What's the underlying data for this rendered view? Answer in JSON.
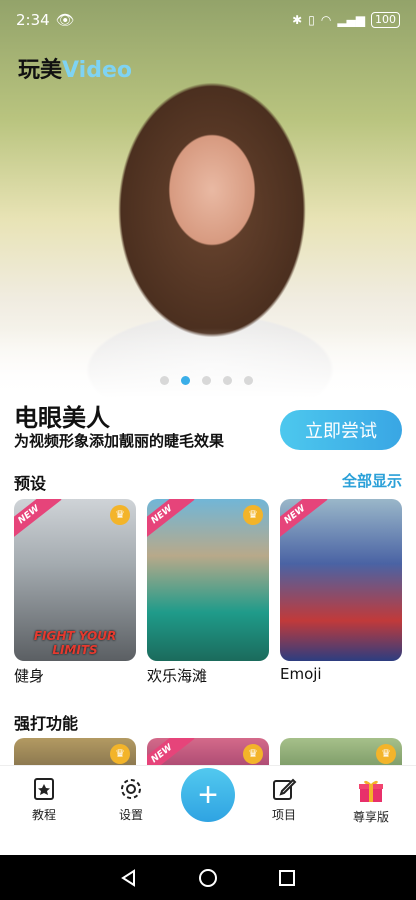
{
  "status_bar": {
    "time": "2:34",
    "battery": "100"
  },
  "app": {
    "logo_cn": "玩美",
    "logo_en": "Video"
  },
  "hero": {
    "slide_count": 5,
    "active_slide": 2
  },
  "feature": {
    "title": "电眼美人",
    "subtitle": "为视频形象添加靓丽的睫毛效果",
    "cta_label": "立即尝试"
  },
  "presets": {
    "title": "预设",
    "see_all": "全部显示",
    "items": [
      {
        "label": "健身",
        "caption": "FIGHT YOUR LIMITS",
        "badge": "NEW"
      },
      {
        "label": "欢乐海滩",
        "badge": "NEW"
      },
      {
        "label": "Emoji",
        "badge": "NEW"
      }
    ]
  },
  "features_section": {
    "title": "强打功能",
    "badge": "NEW"
  },
  "bottom_nav": {
    "items": [
      {
        "label": "教程",
        "icon": "tutorial-icon"
      },
      {
        "label": "设置",
        "icon": "gear-icon"
      },
      {
        "label": "项目",
        "icon": "edit-icon"
      },
      {
        "label": "尊享版",
        "icon": "gift-icon"
      }
    ]
  },
  "colors": {
    "accent": "#3aaee8",
    "ribbon": "#e6447a",
    "crown": "#f3b42a"
  }
}
